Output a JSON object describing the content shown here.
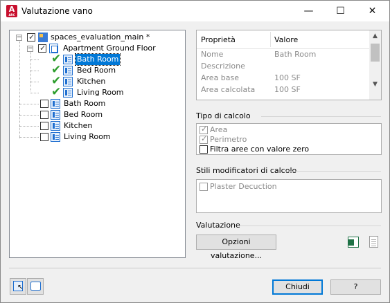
{
  "window": {
    "title": "Valutazione vano",
    "app_icon_letter": "A",
    "app_icon_sub": "ARC",
    "min_glyph": "—",
    "max_glyph": "☐",
    "close_glyph": "✕"
  },
  "tree": {
    "root": {
      "label": "spaces_evaluation_main *",
      "checked": true
    },
    "floor": {
      "label": "Apartment Ground Floor",
      "checked": true
    },
    "floor_children": [
      {
        "label": "Bath Room",
        "selected": true
      },
      {
        "label": "Bed Room"
      },
      {
        "label": "Kitchen"
      },
      {
        "label": "Living Room"
      }
    ],
    "root_children": [
      {
        "label": "Bath Room"
      },
      {
        "label": "Bed Room"
      },
      {
        "label": "Kitchen"
      },
      {
        "label": "Living Room"
      }
    ]
  },
  "properties": {
    "col_property": "Proprietà",
    "col_value": "Valore",
    "rows": [
      {
        "name": "Nome",
        "value": "Bath Room"
      },
      {
        "name": "Descrizione",
        "value": ""
      },
      {
        "name": "Area base",
        "value": "100  SF"
      },
      {
        "name": "Area calcolata",
        "value": "100  SF"
      }
    ]
  },
  "calc": {
    "title": "Tipo di calcolo",
    "options": [
      {
        "label": "Area",
        "checked": true,
        "disabled": true
      },
      {
        "label": "Perimetro",
        "checked": true,
        "disabled": true
      },
      {
        "label": "Filtra aree con valore zero",
        "checked": false,
        "disabled": false
      }
    ]
  },
  "modifiers": {
    "title": "Stili modificatori di calcolo",
    "items": [
      {
        "label": "Plaster Decuction",
        "checked": false
      }
    ]
  },
  "evaluation": {
    "title": "Valutazione",
    "options_button": "Opzioni valutazione..."
  },
  "footer": {
    "close_button": "Chiudi",
    "help_button": "?"
  },
  "icons": {
    "tick": "✔",
    "scroll_up": "▲",
    "scroll_down": "▼",
    "expander_minus": "−"
  }
}
